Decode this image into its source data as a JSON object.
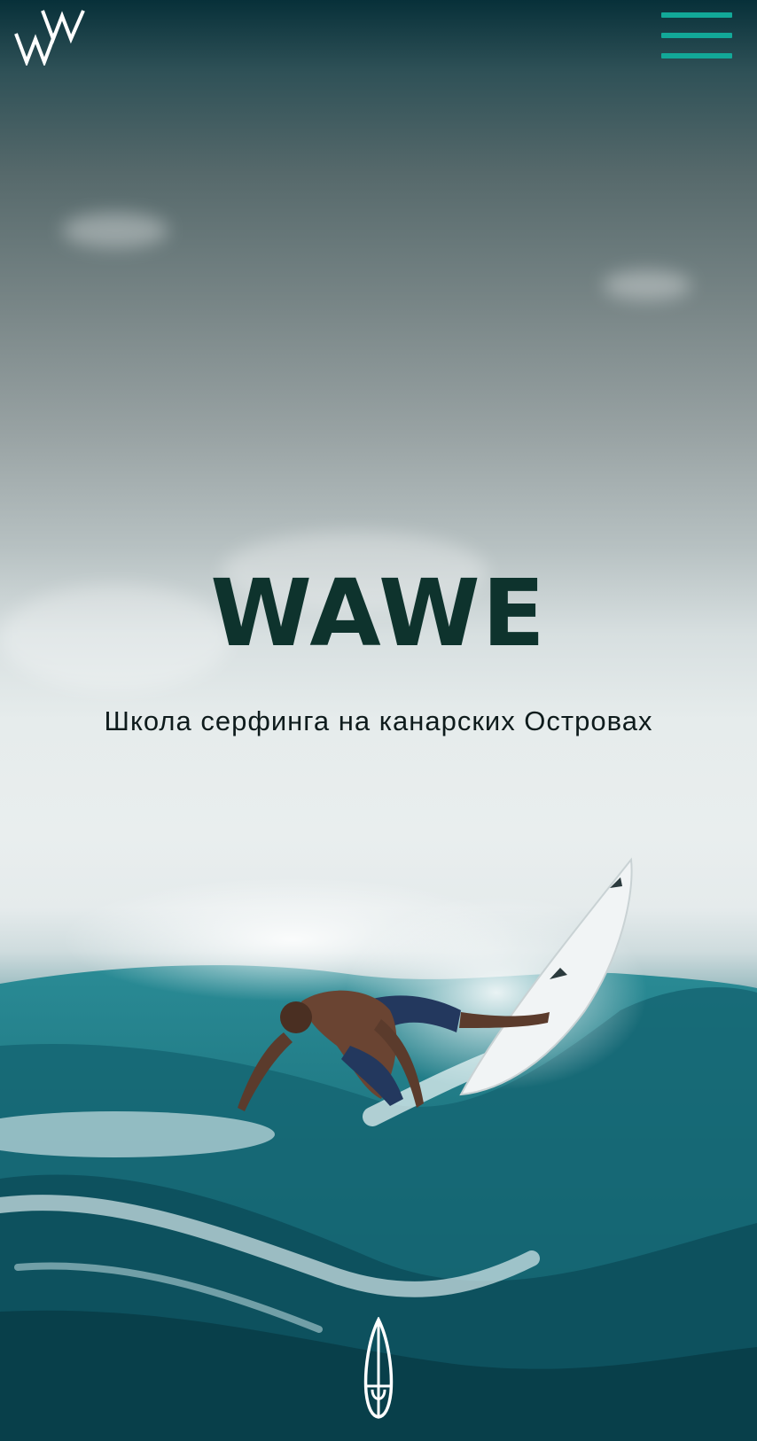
{
  "header": {
    "logo_alt": "WW logo",
    "menu_label": "menu"
  },
  "hero": {
    "title": "WAWE",
    "subtitle": "Школа серфинга на канарских Островах"
  },
  "icons": {
    "logo": "ww-logo-icon",
    "menu": "hamburger-menu-icon",
    "scroll": "surfboard-icon"
  },
  "colors": {
    "accent": "#12a898",
    "title": "#0e332d",
    "subtitle": "#0e1b1c",
    "ocean": "#1a6672"
  }
}
